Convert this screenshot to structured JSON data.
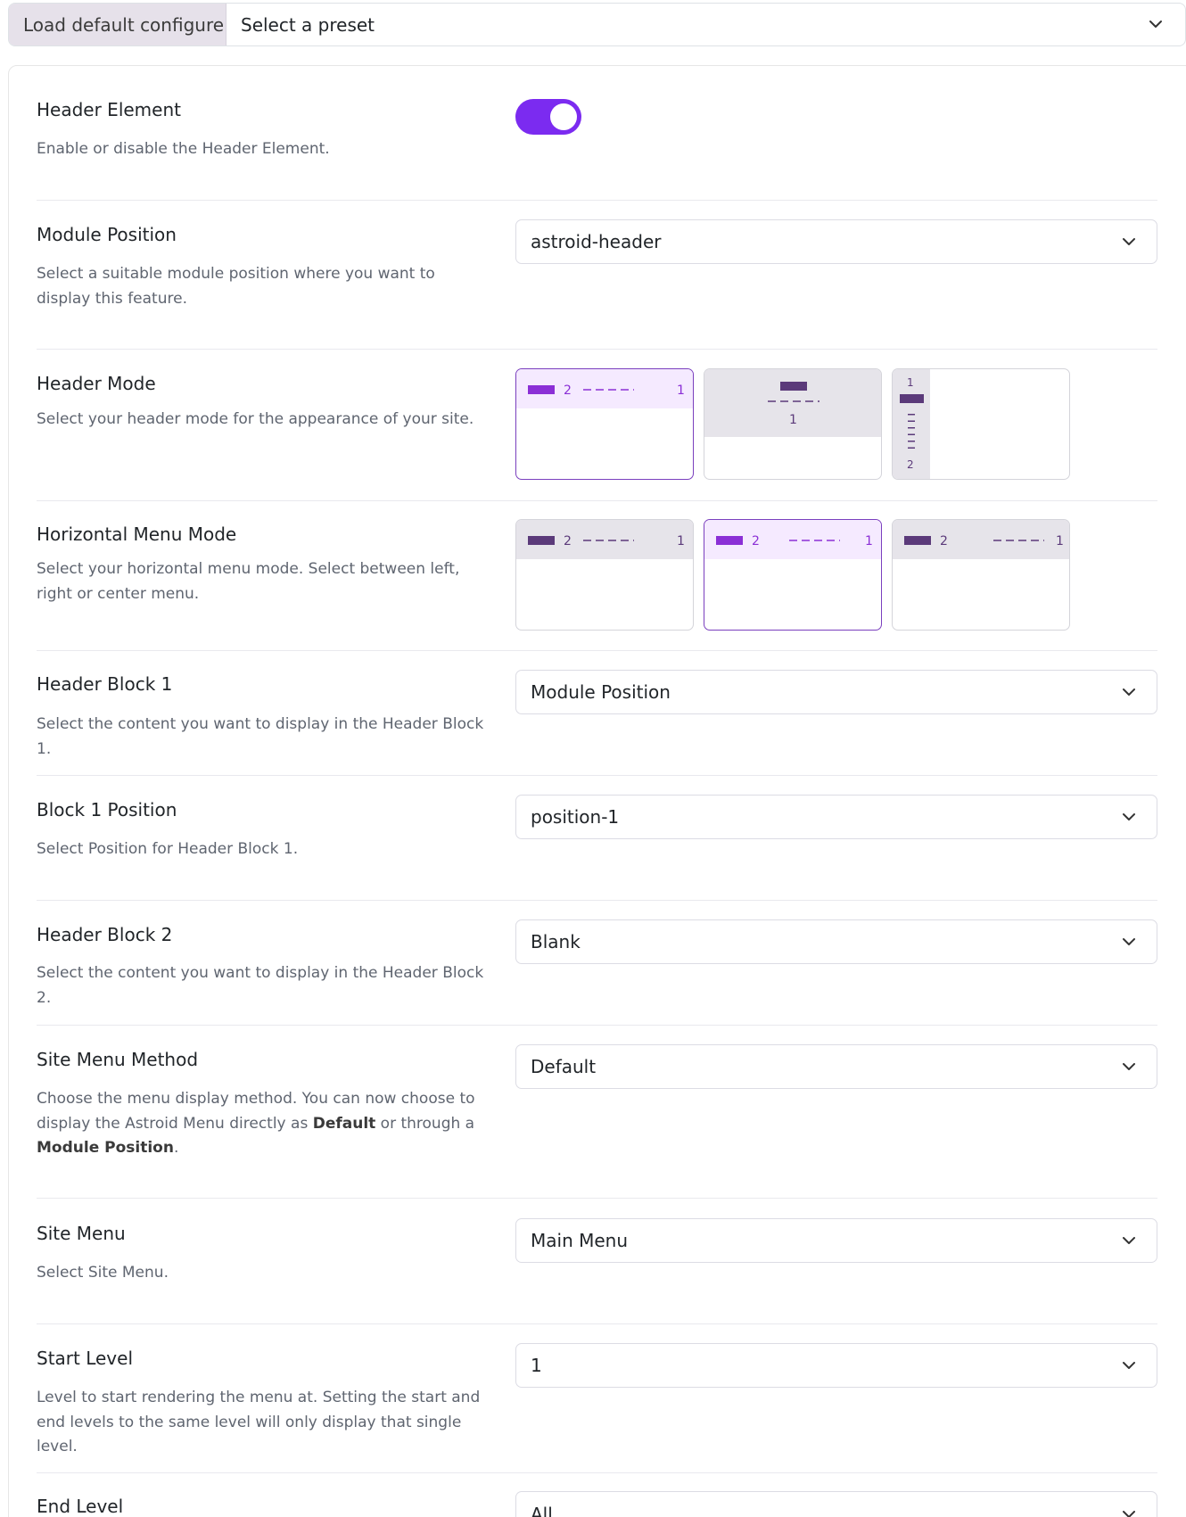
{
  "preset": {
    "load_label": "Load default configure",
    "select_placeholder": "Select a preset"
  },
  "settings": [
    {
      "label": "Header Element",
      "desc": "Enable or disable the Header Element.",
      "control": "toggle",
      "enabled": true
    },
    {
      "label": "Module Position",
      "desc": "Select a suitable module position where you want to display this feature.",
      "control": "select",
      "value": "astroid-header"
    },
    {
      "label": "Header Mode",
      "desc": "Select your header mode for the appearance of your site.",
      "control": "image-options",
      "selected_index": 0
    },
    {
      "label": "Horizontal Menu Mode",
      "desc": "Select your horizontal menu mode. Select between left, right or center menu.",
      "control": "image-options",
      "selected_index": 1
    },
    {
      "label": "Header Block 1",
      "desc": "Select the content you want to display in the Header Block 1.",
      "control": "select",
      "value": "Module Position"
    },
    {
      "label": "Block 1 Position",
      "desc": "Select Position for Header Block 1.",
      "control": "select",
      "value": "position-1"
    },
    {
      "label": "Header Block 2",
      "desc": "Select the content you want to display in the Header Block 2.",
      "control": "select",
      "value": "Blank"
    },
    {
      "label": "Site Menu Method",
      "desc_parts": [
        "Choose the menu display method. You can now choose to display the Astroid Menu directly as ",
        "Default",
        " or through a ",
        "Module Position",
        "."
      ],
      "control": "select",
      "value": "Default"
    },
    {
      "label": "Site Menu",
      "desc": "Select Site Menu.",
      "control": "select",
      "value": "Main Menu"
    },
    {
      "label": "Start Level",
      "desc": "Level to start rendering the menu at. Setting the start and end levels to the same level will only display that single level.",
      "control": "select",
      "value": "1"
    },
    {
      "label": "End Level",
      "control": "select",
      "value": "All"
    }
  ],
  "header_mode_thumbs": [
    {
      "labels": [
        "2",
        "1"
      ]
    },
    {
      "labels": [
        "1"
      ]
    },
    {
      "labels": [
        "1",
        "2"
      ]
    }
  ],
  "menu_mode_thumbs": [
    {
      "labels": [
        "2",
        "1"
      ]
    },
    {
      "labels": [
        "2",
        "1"
      ]
    },
    {
      "labels": [
        "2",
        "1"
      ]
    }
  ],
  "colors": {
    "accent": "#7b2bf0",
    "thumb_bar": "#5b3a7a",
    "thumb_selected_bar": "#8b2fd6",
    "thumb_header_bg": "#e6e4ea",
    "thumb_selected_header_bg": "#f5eaff"
  },
  "icons": {
    "chevron": "chevron-down-icon"
  }
}
